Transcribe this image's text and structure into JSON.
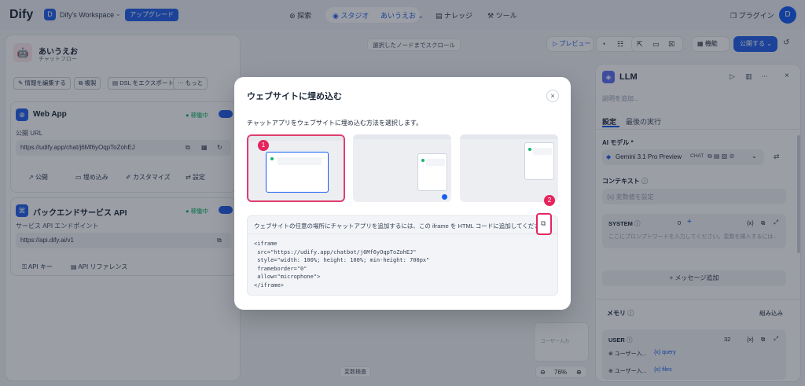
{
  "topbar": {
    "logo": "Dify",
    "workspace_initial": "D",
    "workspace_name": "Dify's Workspace",
    "upgrade_label": "アップグレード",
    "nav_explore": "探索",
    "nav_studio": "スタジオ",
    "nav_app": "あいうえお",
    "nav_knowledge": "ナレッジ",
    "nav_tools": "ツール",
    "plugins": "プラグイン",
    "avatar": "D"
  },
  "left": {
    "app_name": "あいうえお",
    "app_type": "チャットフロー",
    "btn_edit": "情報を編集する",
    "btn_copy": "複製",
    "btn_export": "DSL をエクスポート",
    "btn_more": "もっと",
    "webapp_title": "Web App",
    "webapp_status": "稼働中",
    "public_url_label": "公開 URL",
    "public_url": "https://udify.app/chat/j6Mf6yOqpToZohEJ",
    "act_publish": "公開",
    "act_embed": "埋め込み",
    "act_customize": "カスタマイズ",
    "act_settings": "設定",
    "backend_title": "バックエンドサービス API",
    "backend_status": "稼働中",
    "api_endpoint_label": "サービス API エンドポイント",
    "api_endpoint": "https://api.dify.ai/v1",
    "act_apikey": "API キー",
    "act_apiref": "API リファレンス"
  },
  "canvas": {
    "scroll_btn": "選択したノードまでスクロール",
    "preview": "プレビュー",
    "features": "機能",
    "publish": "公開する",
    "var_check": "変数検査",
    "zoom": "76%",
    "minimap_text": "ユーザー入力"
  },
  "right": {
    "node_title": "LLM",
    "desc_placeholder": "説明を追加...",
    "tab_settings": "設定",
    "tab_last_run": "最後の実行",
    "model_label": "AI モデル",
    "model_name": "Gemini 3.1 Pro Preview",
    "model_badge": "CHAT",
    "context_label": "コンテキスト",
    "context_placeholder": "変数値を設定",
    "system_label": "SYSTEM",
    "system_count": "0",
    "system_placeholder": "ここにプロンプトワードを入力してください。変数を挿入するには...",
    "add_message": "+ メッセージ追加",
    "memory_label": "メモリ",
    "memory_builtin": "組み込み",
    "user_label": "USER",
    "user_count": "32",
    "user_var1": "ユーザー入...",
    "user_tag1": "{x} query",
    "user_var2": "ユーザー入...",
    "user_tag2": "{x} files"
  },
  "modal": {
    "title": "ウェブサイトに埋め込む",
    "desc": "チャットアプリをウェブサイトに埋め込む方法を選択します。",
    "instruction": "ウェブサイトの任意の場所にチャットアプリを追加するには、この iframe を HTML コードに追加してください。",
    "code": "<iframe\n src=\"https://udify.app/chatbot/j6Mf6yOqpToZohEJ\"\n style=\"width: 100%; height: 100%; min-height: 700px\"\n frameborder=\"0\"\n allow=\"microphone\">\n</iframe>",
    "marker1": "1",
    "marker2": "2"
  },
  "colors": {
    "accent": "#2563eb",
    "marker": "#e5245e",
    "status": "#12b76a"
  }
}
